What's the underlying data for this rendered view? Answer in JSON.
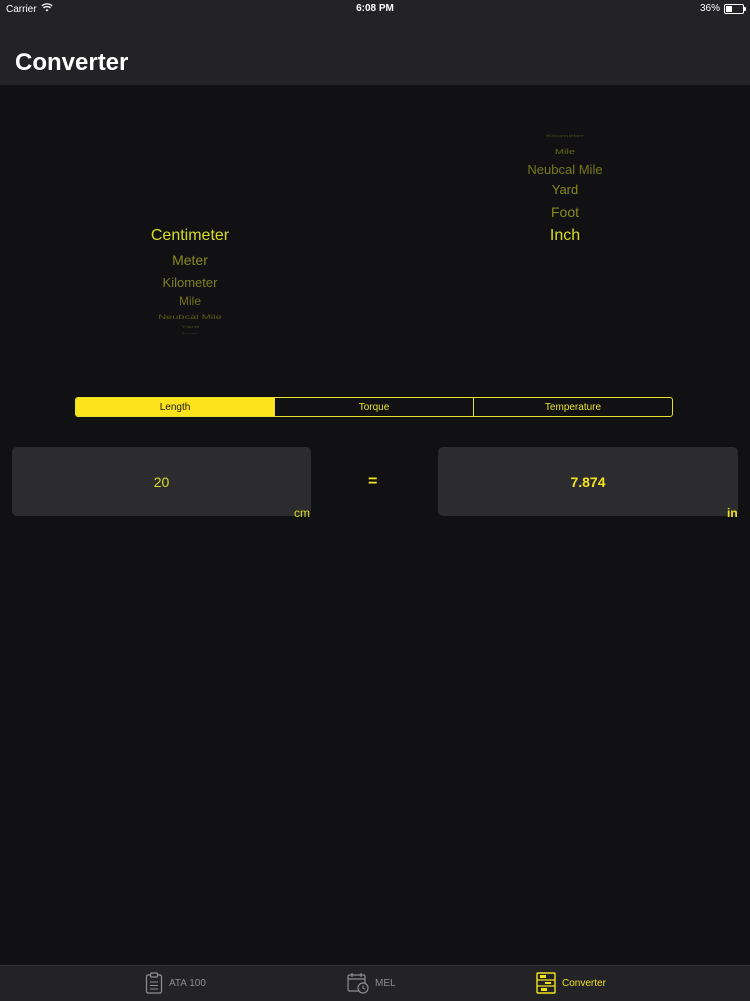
{
  "status": {
    "carrier": "Carrier",
    "time": "6:08 PM",
    "battery": "36%"
  },
  "nav": {
    "title": "Converter"
  },
  "pickers": {
    "from": [
      "Centimeter",
      "Meter",
      "Kilometer",
      "Mile",
      "Neubcal Mile",
      "Yard",
      "Foot"
    ],
    "to": [
      "Kilometer",
      "Mile",
      "Neubcal Mile",
      "Yard",
      "Foot",
      "Inch"
    ],
    "from_selected": "Centimeter",
    "to_selected": "Inch"
  },
  "segments": [
    "Length",
    "Torque",
    "Temperature"
  ],
  "converter": {
    "input_value": "20",
    "input_unit": "cm",
    "equals": "=",
    "output_value": "7.874",
    "output_unit": "in"
  },
  "tabs": [
    "ATA 100",
    "MEL",
    "Converter"
  ],
  "colors": {
    "accent": "#fce31b",
    "background": "#111113",
    "bar": "#232325"
  }
}
